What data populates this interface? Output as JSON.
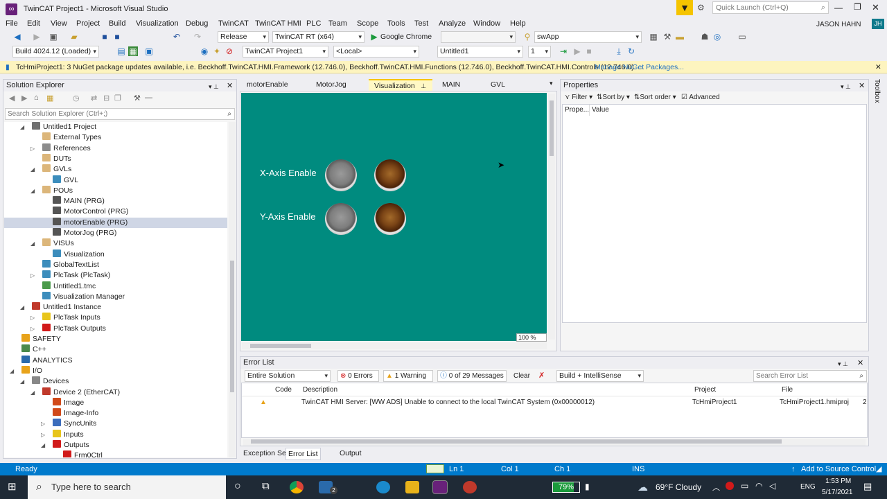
{
  "window": {
    "title": "TwinCAT Project1 - Microsoft Visual Studio",
    "quick_launch_placeholder": "Quick Launch (Ctrl+Q)",
    "user": "JASON HAHN",
    "user_initials": "JH"
  },
  "menu": [
    "File",
    "Edit",
    "View",
    "Project",
    "Build",
    "Visualization",
    "Debug",
    "TwinCAT",
    "TwinCAT HMI",
    "PLC",
    "Team",
    "Scope",
    "Tools",
    "Test",
    "Analyze",
    "Window",
    "Help"
  ],
  "toolbar1": {
    "config": "Release",
    "platform": "TwinCAT RT (x64)",
    "run_target": "Google Chrome",
    "search_combo": "swApp"
  },
  "toolbar2": {
    "build": "Build 4024.12 (Loaded)",
    "project": "TwinCAT Project1",
    "target": "<Local>",
    "plc_project": "Untitled1",
    "instance": "1"
  },
  "infobar": {
    "message": "TcHmiProject1: 3 NuGet package updates available, i.e. Beckhoff.TwinCAT.HMI.Framework (12.746.0), Beckhoff.TwinCAT.HMI.Functions (12.746.0), Beckhoff.TwinCAT.HMI.Controls (12.746.0). ...",
    "link": "Manage NuGet Packages..."
  },
  "solution_explorer": {
    "title": "Solution Explorer",
    "search_placeholder": "Search Solution Explorer (Ctrl+;)",
    "items": [
      {
        "label": "Untitled1 Project",
        "indent": 0,
        "arrow": "▲",
        "color": "#6f6f6f"
      },
      {
        "label": "External Types",
        "indent": 1,
        "arrow": "",
        "color": "#dcb67a"
      },
      {
        "label": "References",
        "indent": 1,
        "arrow": "▷",
        "color": "#8c8c8c"
      },
      {
        "label": "DUTs",
        "indent": 1,
        "arrow": "",
        "color": "#dcb67a"
      },
      {
        "label": "GVLs",
        "indent": 1,
        "arrow": "▲",
        "color": "#dcb67a"
      },
      {
        "label": "GVL",
        "indent": 2,
        "arrow": "",
        "color": "#3c8dbc"
      },
      {
        "label": "POUs",
        "indent": 1,
        "arrow": "▲",
        "color": "#dcb67a"
      },
      {
        "label": "MAIN (PRG)",
        "indent": 2,
        "arrow": "",
        "color": "#555"
      },
      {
        "label": "MotorControl (PRG)",
        "indent": 2,
        "arrow": "",
        "color": "#555"
      },
      {
        "label": "motorEnable (PRG)",
        "indent": 2,
        "arrow": "",
        "color": "#555"
      },
      {
        "label": "MotorJog (PRG)",
        "indent": 2,
        "arrow": "",
        "color": "#555"
      },
      {
        "label": "VISUs",
        "indent": 1,
        "arrow": "▲",
        "color": "#dcb67a"
      },
      {
        "label": "Visualization",
        "indent": 2,
        "arrow": "",
        "color": "#3c8dbc"
      },
      {
        "label": "GlobalTextList",
        "indent": 1,
        "arrow": "",
        "color": "#3c8dbc"
      },
      {
        "label": "PlcTask (PlcTask)",
        "indent": 1,
        "arrow": "▷",
        "color": "#3c8dbc"
      },
      {
        "label": "Untitled1.tmc",
        "indent": 1,
        "arrow": "",
        "color": "#4a9a4a"
      },
      {
        "label": "Visualization Manager",
        "indent": 1,
        "arrow": "",
        "color": "#3c8dbc"
      },
      {
        "label": "Untitled1 Instance",
        "indent": 0,
        "arrow": "▲",
        "color": "#c0392b"
      },
      {
        "label": "PlcTask Inputs",
        "indent": 1,
        "arrow": "▷",
        "color": "#e8c51a"
      },
      {
        "label": "PlcTask Outputs",
        "indent": 1,
        "arrow": "▷",
        "color": "#d11a1a"
      },
      {
        "label": "SAFETY",
        "indent": -1,
        "arrow": "",
        "color": "#e8a31a"
      },
      {
        "label": "C++",
        "indent": -1,
        "arrow": "",
        "color": "#4a8a4a"
      },
      {
        "label": "ANALYTICS",
        "indent": -1,
        "arrow": "",
        "color": "#2a6aaa"
      },
      {
        "label": "I/O",
        "indent": -1,
        "arrow": "▲",
        "color": "#e8a31a"
      },
      {
        "label": "Devices",
        "indent": 0,
        "arrow": "▲",
        "color": "#888"
      },
      {
        "label": "Device 2 (EtherCAT)",
        "indent": 1,
        "arrow": "▲",
        "color": "#c0392b"
      },
      {
        "label": "Image",
        "indent": 2,
        "arrow": "",
        "color": "#d14a1a"
      },
      {
        "label": "Image-Info",
        "indent": 2,
        "arrow": "",
        "color": "#d14a1a"
      },
      {
        "label": "SyncUnits",
        "indent": 2,
        "arrow": "▷",
        "color": "#3c6dbc"
      },
      {
        "label": "Inputs",
        "indent": 2,
        "arrow": "▷",
        "color": "#e8c51a"
      },
      {
        "label": "Outputs",
        "indent": 2,
        "arrow": "▲",
        "color": "#d11a1a"
      },
      {
        "label": "Frm0Ctrl",
        "indent": 3,
        "arrow": "",
        "color": "#d11a1a"
      }
    ],
    "selected_index": 9
  },
  "editor_tabs": [
    {
      "label": "motorEnable",
      "active": false
    },
    {
      "label": "MotorJog",
      "active": false
    },
    {
      "label": "Visualization",
      "active": true
    },
    {
      "label": "MAIN",
      "active": false
    },
    {
      "label": "GVL",
      "active": false
    }
  ],
  "visualization": {
    "x_label": "X-Axis Enable",
    "y_label": "Y-Axis Enable",
    "zoom": "100 %"
  },
  "properties": {
    "title": "Properties",
    "filter": "Filter",
    "sort_by": "Sort by",
    "sort_order": "Sort order",
    "advanced": "Advanced",
    "col_prop": "Prope...",
    "col_value": "Value"
  },
  "error_list": {
    "title": "Error List",
    "scope": "Entire Solution",
    "errors": "0 Errors",
    "warnings": "1 Warning",
    "messages": "0 of 29 Messages",
    "clear": "Clear",
    "source": "Build + IntelliSense",
    "search_placeholder": "Search Error List",
    "columns": [
      "Code",
      "Description",
      "Project",
      "File"
    ],
    "rows": [
      {
        "code": "",
        "description": "TwinCAT HMI Server: [WW ADS] Unable to connect to the local TwinCAT System (0x00000012)",
        "project": "TcHmiProject1",
        "file": "TcHmiProject1.hmiproj",
        "line": "2"
      }
    ]
  },
  "bottom_tabs": [
    "Exception Settings",
    "Error List",
    "Output"
  ],
  "statusbar": {
    "ready": "Ready",
    "ln": "Ln 1",
    "col": "Col 1",
    "ch": "Ch 1",
    "ins": "INS",
    "source_control": "Add to Source Control"
  },
  "taskbar": {
    "search_placeholder": "Type here to search",
    "battery": "79%",
    "weather": "69°F  Cloudy",
    "lang": "ENG",
    "time": "1:53 PM",
    "date": "5/17/2021",
    "mail_badge": "2"
  },
  "side_tab": "Toolbox"
}
